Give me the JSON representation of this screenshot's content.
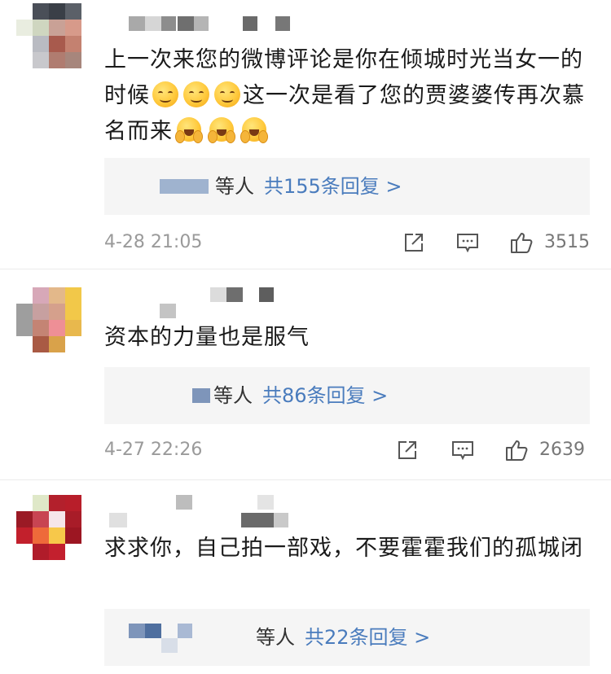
{
  "comments": [
    {
      "text_segments": [
        "上一次来您的微博评论是你在倾城时光当女一的时候",
        "这一次是看了您的贾婆婆传再次慕名而来"
      ],
      "emojis_after_first": [
        "smile-emoji",
        "smile-emoji",
        "smile-emoji"
      ],
      "emojis_after_second": [
        "hug-emoji",
        "hug-emoji",
        "hug-emoji"
      ],
      "reply_who": "等人",
      "reply_count": "共155条回复 >",
      "date": "4-28 21:05",
      "likes": "3515"
    },
    {
      "text": "资本的力量也是服气",
      "reply_who": "等人",
      "reply_count": "共86条回复 >",
      "date": "4-27 22:26",
      "likes": "2639"
    },
    {
      "text": "求求你，自己拍一部戏，不要霍霍我们的孤城闭",
      "reply_who": "等人",
      "reply_count": "共22条回复 >"
    }
  ],
  "icons": [
    "share-icon",
    "comment-icon",
    "like-icon"
  ],
  "colors": {
    "link": "#4a7cbd",
    "reply_bg": "#f5f5f5",
    "date": "#9a9a9a"
  }
}
